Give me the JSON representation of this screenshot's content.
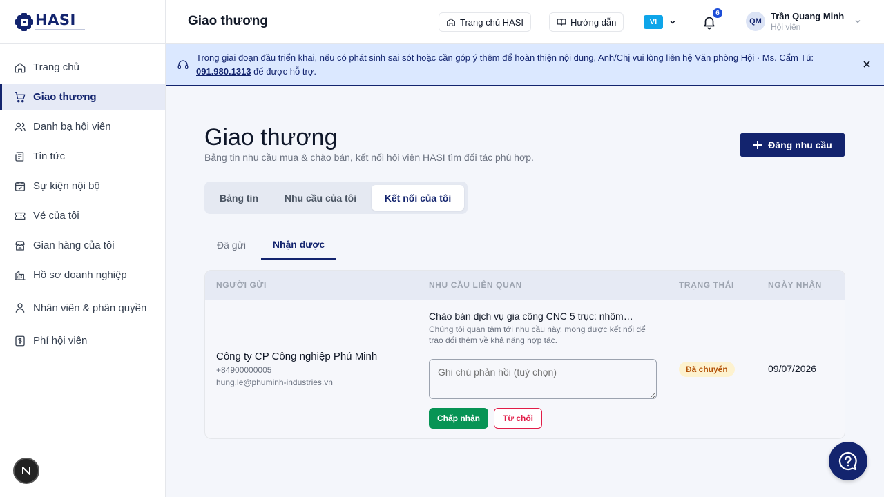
{
  "brand": {
    "name": "HASI"
  },
  "sidebar": {
    "items": [
      {
        "label": "Trang chủ",
        "icon": "home-icon"
      },
      {
        "label": "Giao thương",
        "icon": "cart-icon",
        "active": true
      },
      {
        "label": "Danh bạ hội viên",
        "icon": "users-icon"
      },
      {
        "label": "Tin tức",
        "icon": "news-icon"
      },
      {
        "label": "Sự kiện nội bộ",
        "icon": "calendar-icon"
      },
      {
        "label": "Vé của tôi",
        "icon": "ticket-icon"
      },
      {
        "label": "Gian hàng của tôi",
        "icon": "store-icon"
      },
      {
        "label": "Hồ sơ doanh nghiệp",
        "icon": "building-icon"
      },
      {
        "label": "Nhân viên & phân quyền",
        "icon": "user-icon"
      },
      {
        "label": "Phí hội viên",
        "icon": "dollar-icon"
      }
    ],
    "badge_letter": "N"
  },
  "header": {
    "title": "Giao thương",
    "home_link": "Trang chủ HASI",
    "guide_link": "Hướng dẫn",
    "language": "VI",
    "notification_count": "6",
    "user": {
      "initials": "QM",
      "name": "Trần Quang Minh",
      "role": "Hội viên"
    }
  },
  "banner": {
    "text_before": "Trong giai đoạn đầu triển khai, nếu có phát sinh sai sót hoặc cần góp ý thêm để hoàn thiện nội dung, Anh/Chị vui lòng liên hệ Văn phòng Hội · Ms. Cẩm Tú: ",
    "phone": "091.980.1313",
    "text_after": " để được hỗ trợ."
  },
  "main": {
    "title": "Giao thương",
    "subtitle": "Bảng tin nhu cầu mua & chào bán, kết nối hội viên HASI tìm đối tác phù hợp.",
    "post_button": "Đăng nhu cầu",
    "tabs": [
      {
        "label": "Bảng tin"
      },
      {
        "label": "Nhu cầu của tôi"
      },
      {
        "label": "Kết nối của tôi",
        "active": true
      }
    ],
    "subtabs": [
      {
        "label": "Đã gửi"
      },
      {
        "label": "Nhận được",
        "active": true
      }
    ],
    "table": {
      "headers": [
        "Người gửi",
        "Nhu cầu liên quan",
        "Trạng thái",
        "Ngày nhận"
      ],
      "rows": [
        {
          "sender_name": "Công ty CP Công nghiệp Phú Minh",
          "sender_phone": "+84900000005",
          "sender_email": "hung.le@phuminh-industries.vn",
          "need_title": "Chào bán dịch vụ gia công CNC 5 trục: nhôm…",
          "need_message": "Chúng tôi quan tâm tới nhu cầu này, mong được kết nối để trao đổi thêm về khả năng hợp tác.",
          "note_placeholder": "Ghi chú phản hồi (tuỳ chọn)",
          "accept_label": "Chấp nhận",
          "reject_label": "Từ chối",
          "status": "Đã chuyển",
          "date": "09/07/2026"
        }
      ]
    }
  },
  "colors": {
    "primary": "#13246e",
    "accept": "#079455",
    "reject": "#e11d48",
    "status_bg": "#fdf2cf",
    "status_fg": "#b45309"
  }
}
